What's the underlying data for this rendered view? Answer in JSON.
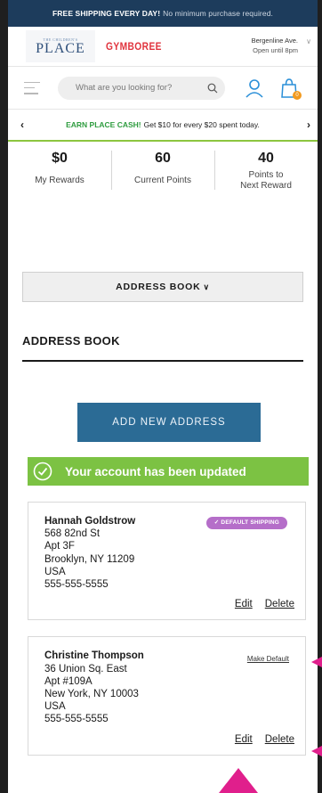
{
  "promo": {
    "bold": "FREE SHIPPING EVERY DAY!",
    "rest": "No minimum purchase required."
  },
  "brand": {
    "tcp_small": "THE CHILDREN'S",
    "tcp_big": "PLACE",
    "gymboree": "GYMBOREE"
  },
  "store": {
    "name": "Bergenline Ave.",
    "hours": "Open until 8pm"
  },
  "search": {
    "placeholder": "What are you looking for?"
  },
  "cart": {
    "count": "0"
  },
  "cash_banner": {
    "highlight": "EARN PLACE CASH!",
    "text": "Get $10 for every $20 spent today."
  },
  "stats": [
    {
      "value": "$0",
      "label": "My Rewards"
    },
    {
      "value": "60",
      "label": "Current Points"
    },
    {
      "value": "40",
      "label_line1": "Points to",
      "label_line2": "Next Reward"
    }
  ],
  "address_book_dropdown": {
    "label": "ADDRESS BOOK"
  },
  "address_book_heading": "ADDRESS BOOK",
  "add_button": "ADD NEW ADDRESS",
  "update_message": "Your account has been updated",
  "addresses": [
    {
      "name": "Hannah Goldstrow",
      "line1": "568 82nd St",
      "line2": "Apt 3F",
      "city_line": "Brooklyn, NY 11209",
      "country": "USA",
      "phone": "555-555-5555",
      "badge": "✓ DEFAULT SHIPPING",
      "edit": "Edit",
      "delete": "Delete"
    },
    {
      "name": "Christine Thompson",
      "line1": "36 Union Sq. East",
      "line2": "Apt #109A",
      "city_line": "New York, NY 10003",
      "country": "USA",
      "phone": "555-555-5555",
      "make_default": "Make Default",
      "edit": "Edit",
      "delete": "Delete"
    }
  ],
  "colors": {
    "promo_bg": "#1d3c5c",
    "accent_green": "#7cc243",
    "button_blue": "#2b6b95",
    "badge_purple": "#b56ec9",
    "annotation_pink": "#e01f8c"
  }
}
